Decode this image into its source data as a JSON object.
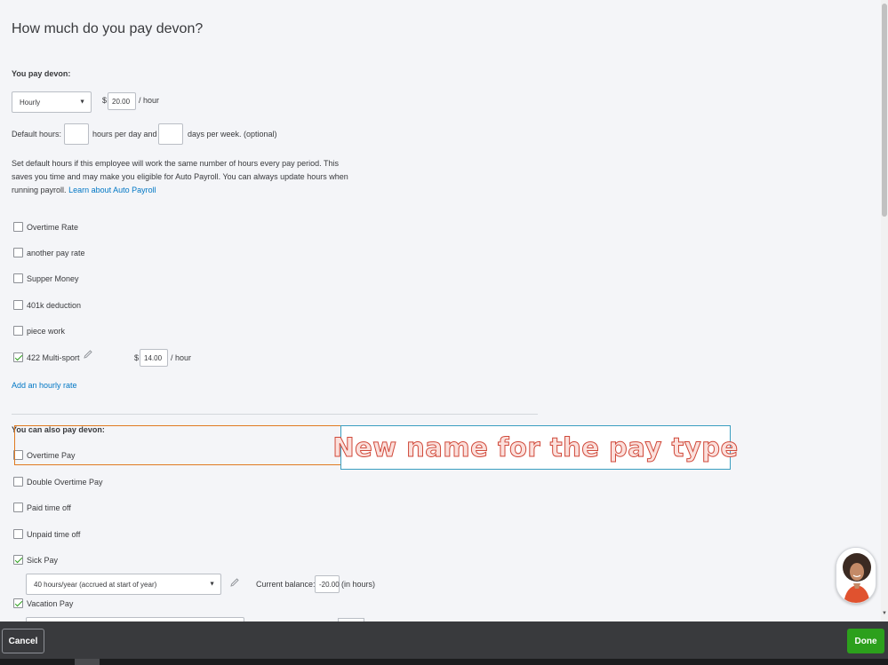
{
  "page": {
    "title": "How much do you pay devon?"
  },
  "pay": {
    "heading": "You pay devon:",
    "type_value": "Hourly",
    "currency": "$",
    "rate_value": "20.00",
    "per_hour": "/ hour"
  },
  "default_hours": {
    "label": "Default hours:",
    "hours_per_day_text": "hours per day and",
    "days_per_week_text": "days per week. (optional)",
    "hours_value": "",
    "days_value": ""
  },
  "help_text": "Set default hours if this employee will work the same number of hours every pay period. This saves you time and may make you eligible for Auto Payroll. You can always update hours when running payroll.",
  "help_link": "Learn about Auto Payroll",
  "pay_rates": [
    {
      "label": "Overtime Rate",
      "checked": false
    },
    {
      "label": "another pay rate",
      "checked": false
    },
    {
      "label": "Supper Money",
      "checked": false
    },
    {
      "label": "401k deduction",
      "checked": false
    },
    {
      "label": "piece work",
      "checked": false
    },
    {
      "label": "422 Multi-sport",
      "checked": true
    }
  ],
  "multisport": {
    "currency": "$",
    "rate_value": "14.00",
    "per_hour": "/ hour"
  },
  "add_rate_link": "Add an hourly rate",
  "also_pay": {
    "heading": "You can also pay devon:",
    "items": [
      {
        "label": "Overtime Pay",
        "checked": false
      },
      {
        "label": "Double Overtime Pay",
        "checked": false
      },
      {
        "label": "Paid time off",
        "checked": false
      },
      {
        "label": "Unpaid time off",
        "checked": false
      },
      {
        "label": "Sick Pay",
        "checked": true
      },
      {
        "label": "Vacation Pay",
        "checked": true
      }
    ]
  },
  "sick": {
    "accrual_value": "40 hours/year (accrued at start of year)",
    "balance_label": "Current balance:",
    "balance_value": "-20.00",
    "balance_unit": "(in hours)"
  },
  "callout": {
    "text": "New name for the pay type"
  },
  "footer": {
    "cancel_label": "Cancel",
    "done_label": "Done"
  },
  "colors": {
    "accent_green": "#2ca01c",
    "link_blue": "#0077c5",
    "footer": "#393a3d",
    "callout_orange": "#e07a21",
    "callout_blue": "#3a9ec0"
  },
  "icons": {
    "edit": "pencil-icon",
    "dropdown": "chevron-down-icon",
    "checkbox": "checkmark-icon"
  }
}
